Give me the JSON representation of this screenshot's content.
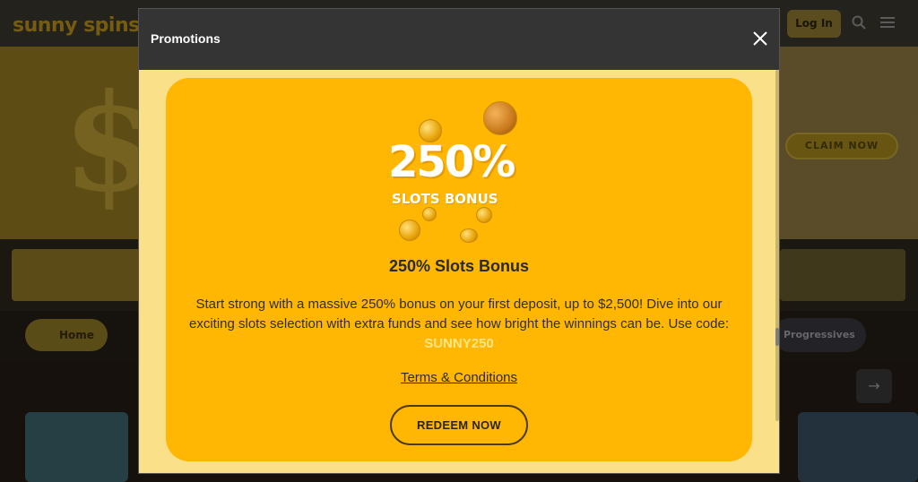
{
  "site": {
    "logo": "sunny spins",
    "login_label": "Log In",
    "claim_label": "CLAIM NOW",
    "tab_home_label": "Home",
    "tab_progressives_label": "Progressives"
  },
  "modal": {
    "title": "Promotions",
    "promo": {
      "art_number": "250%",
      "art_subtitle": "SLOTS BONUS",
      "heading": "250% Slots Bonus",
      "description": "Start strong with a massive 250% bonus on your first deposit, up to $2,500! Dive into our exciting slots selection with extra funds and see how bright the winnings can be. Use code: ",
      "code": "SUNNY250",
      "terms_label": "Terms & Conditions",
      "redeem_label": "REDEEM NOW"
    }
  },
  "colors": {
    "card_bg": "#ffb703",
    "modal_bg": "#fbe08a",
    "header_bg": "#343434",
    "code_color": "#fde68a"
  },
  "icons": [
    "close-icon",
    "search-icon",
    "menu-icon",
    "arrow-right-icon",
    "coin-icon"
  ]
}
